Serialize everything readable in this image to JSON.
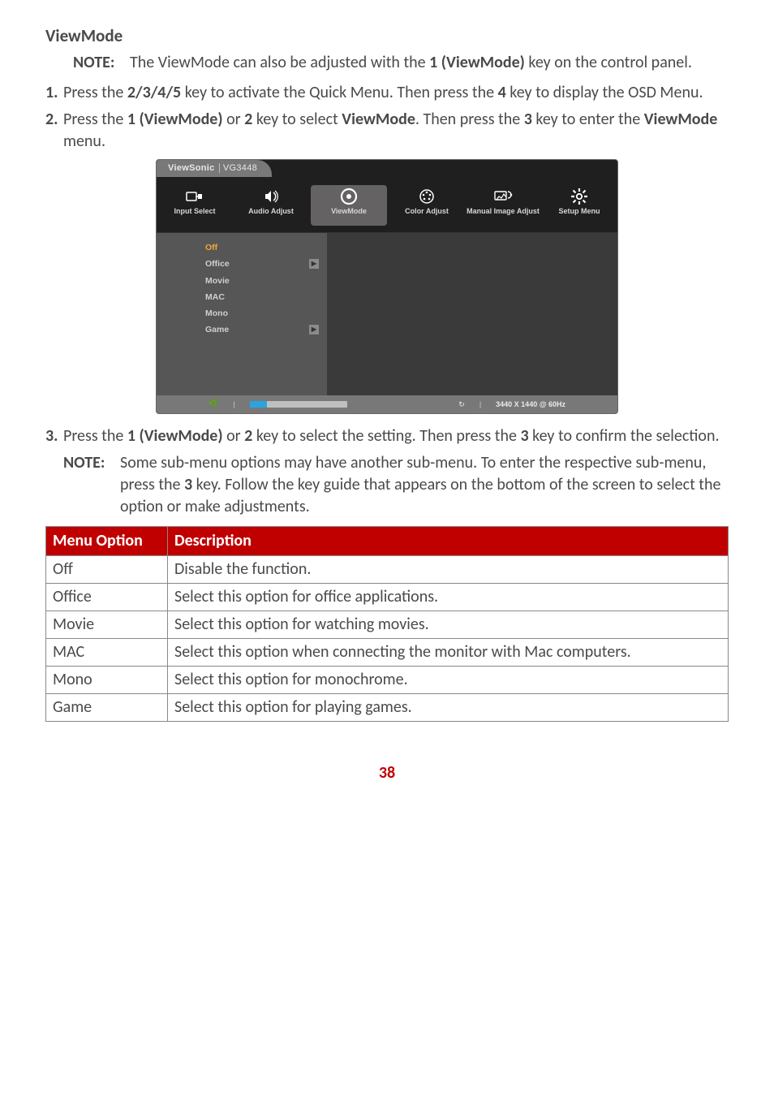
{
  "title": "ViewMode",
  "note1": {
    "label": "NOTE:",
    "text_pre": "The ViewMode can also be adjusted with the ",
    "key": "1 (ViewMode)",
    "text_post": " key on the control panel."
  },
  "steps": [
    {
      "num": "1.",
      "parts": [
        "Press the ",
        "2/3/4/5",
        " key to activate the Quick Menu. Then press the ",
        "4",
        " key to display the OSD Menu."
      ]
    },
    {
      "num": "2.",
      "parts": [
        "Press the ",
        "1 (ViewMode)",
        " or ",
        "2",
        " key to select ",
        "ViewMode",
        ". Then press the ",
        "3",
        " key to enter the ",
        "ViewMode",
        " menu."
      ]
    }
  ],
  "osd": {
    "brand": "ViewSonic",
    "model": "VG3448",
    "tabs": [
      {
        "icon": "input-icon",
        "label": "Input Select"
      },
      {
        "icon": "audio-icon",
        "label": "Audio Adjust"
      },
      {
        "icon": "viewmode-icon",
        "label": "ViewMode",
        "active": true
      },
      {
        "icon": "color-icon",
        "label": "Color Adjust"
      },
      {
        "icon": "manual-icon",
        "label": "Manual Image Adjust"
      },
      {
        "icon": "setup-icon",
        "label": "Setup Menu"
      }
    ],
    "left_menu": [
      {
        "label": "Off",
        "selected": true
      },
      {
        "label": "Office",
        "chev": true
      },
      {
        "label": "Movie"
      },
      {
        "label": "MAC"
      },
      {
        "label": "Mono"
      },
      {
        "label": "Game",
        "chev": true
      }
    ],
    "footer_res": "3440 X 1440 @ 60Hz"
  },
  "step3": {
    "num": "3.",
    "parts": [
      "Press the ",
      "1 (ViewMode)",
      " or ",
      "2",
      " key to select the setting. Then press the ",
      "3",
      " key to confirm the selection."
    ]
  },
  "note2": {
    "label": "NOTE:",
    "parts": [
      "Some sub-menu options may have another sub-menu. To enter the respective sub-menu, press the ",
      "3",
      " key. Follow the key guide that appears on the bottom of the screen to select the option or make adjustments."
    ]
  },
  "table": {
    "header": [
      "Menu Option",
      "Description"
    ],
    "rows": [
      [
        "Off",
        "Disable the function."
      ],
      [
        "Office",
        "Select this option for office applications."
      ],
      [
        "Movie",
        "Select this option for watching movies."
      ],
      [
        "MAC",
        "Select this option when connecting the monitor with Mac computers."
      ],
      [
        "Mono",
        "Select this option for monochrome."
      ],
      [
        "Game",
        "Select this option for playing games."
      ]
    ]
  },
  "page_number": "38"
}
